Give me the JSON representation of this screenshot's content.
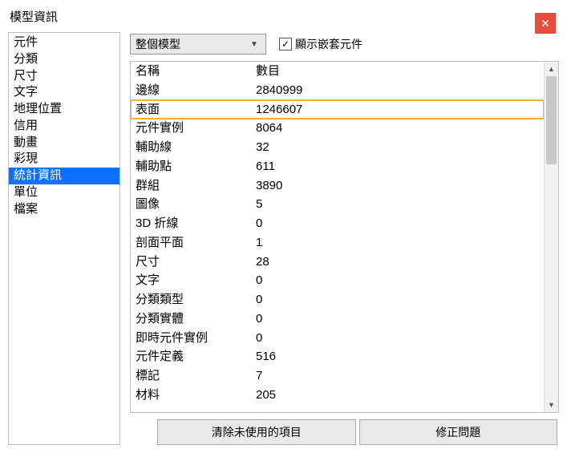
{
  "window": {
    "title": "模型資訊"
  },
  "sidebar": {
    "items": [
      {
        "label": "元件",
        "selected": false
      },
      {
        "label": "分類",
        "selected": false
      },
      {
        "label": "尺寸",
        "selected": false
      },
      {
        "label": "文字",
        "selected": false
      },
      {
        "label": "地理位置",
        "selected": false
      },
      {
        "label": "信用",
        "selected": false
      },
      {
        "label": "動畫",
        "selected": false
      },
      {
        "label": "彩現",
        "selected": false
      },
      {
        "label": "統計資訊",
        "selected": true
      },
      {
        "label": "單位",
        "selected": false
      },
      {
        "label": "檔案",
        "selected": false
      }
    ]
  },
  "scope": {
    "selected": "整個模型",
    "show_nested_label": "顯示嵌套元件",
    "show_nested_checked": true
  },
  "table": {
    "headers": {
      "name": "名稱",
      "count": "數目"
    },
    "rows": [
      {
        "name": "邊線",
        "count": "2840999",
        "hl": false
      },
      {
        "name": "表面",
        "count": "1246607",
        "hl": true
      },
      {
        "name": "元件實例",
        "count": "8064",
        "hl": false
      },
      {
        "name": "輔助線",
        "count": "32",
        "hl": false
      },
      {
        "name": "輔助點",
        "count": "611",
        "hl": false
      },
      {
        "name": "群組",
        "count": "3890",
        "hl": false
      },
      {
        "name": "圖像",
        "count": "5",
        "hl": false
      },
      {
        "name": "3D 折線",
        "count": "0",
        "hl": false
      },
      {
        "name": "剖面平面",
        "count": "1",
        "hl": false
      },
      {
        "name": "尺寸",
        "count": "28",
        "hl": false
      },
      {
        "name": "文字",
        "count": "0",
        "hl": false
      },
      {
        "name": "分類類型",
        "count": "0",
        "hl": false
      },
      {
        "name": "分類實體",
        "count": "0",
        "hl": false
      },
      {
        "name": "即時元件實例",
        "count": "0",
        "hl": false
      },
      {
        "name": "元件定義",
        "count": "516",
        "hl": false
      },
      {
        "name": "標記",
        "count": "7",
        "hl": false
      },
      {
        "name": "材料",
        "count": "205",
        "hl": false
      }
    ]
  },
  "buttons": {
    "purge": "清除未使用的項目",
    "fix": "修正問題"
  }
}
